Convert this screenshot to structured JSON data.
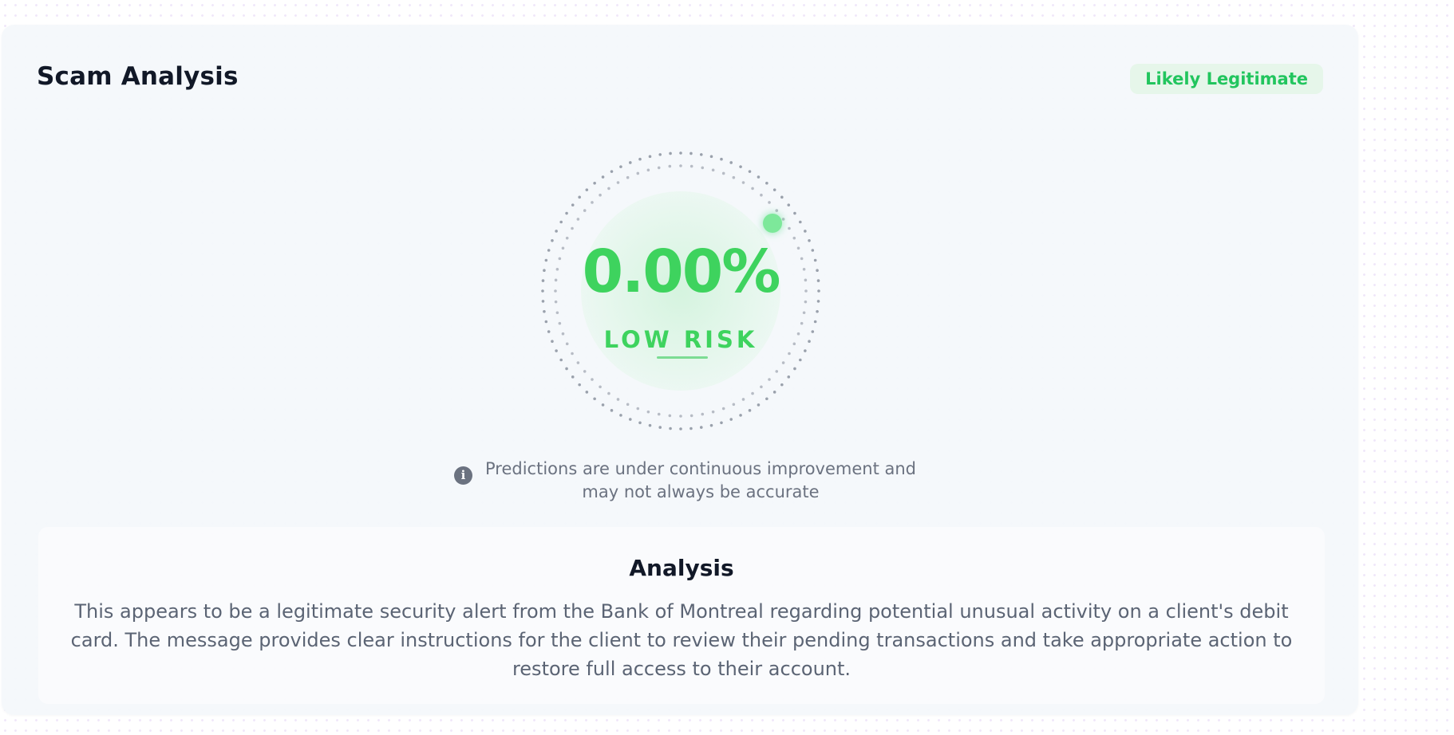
{
  "card": {
    "title": "Scam Analysis",
    "verdict_badge": "Likely Legitimate"
  },
  "gauge": {
    "score_text": "0.00%",
    "score_value": 0.0,
    "risk_level": "LOW RISK"
  },
  "disclaimer": {
    "icon": "info-icon",
    "text": "Predictions are under continuous improvement and may not always be accurate"
  },
  "analysis": {
    "title": "Analysis",
    "body": "This appears to be a legitimate security alert from the Bank of Montreal regarding potential unusual activity on a client's debit card. The message provides clear instructions for the client to review their pending transactions and take appropriate action to restore full access to their account."
  },
  "colors": {
    "accent_green": "#3ed35e",
    "badge_background": "#e6f6ea",
    "text_dark": "#111827",
    "text_muted": "#6b7280"
  }
}
